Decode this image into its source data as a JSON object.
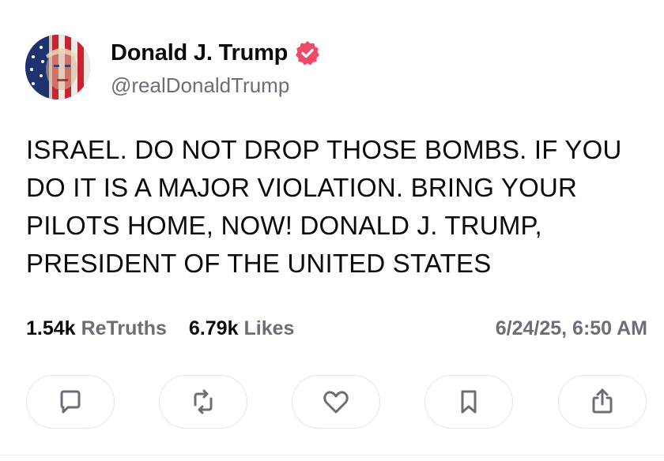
{
  "author": {
    "display_name": "Donald J. Trump",
    "handle": "@realDonaldTrump",
    "verified": true,
    "verified_color": "#ef4b64"
  },
  "post": {
    "text": "ISRAEL. DO NOT DROP THOSE BOMBS. IF YOU DO IT IS A MAJOR VIOLATION. BRING YOUR PILOTS HOME, NOW! DONALD J. TRUMP, PRESIDENT OF THE UNITED STATES"
  },
  "stats": {
    "retruths_count": "1.54k",
    "retruths_label": "ReTruths",
    "likes_count": "6.79k",
    "likes_label": "Likes",
    "timestamp": "6/24/25, 6:50 AM"
  },
  "actions": [
    {
      "icon": "reply-icon"
    },
    {
      "icon": "retruth-icon"
    },
    {
      "icon": "heart-icon"
    },
    {
      "icon": "bookmark-icon"
    },
    {
      "icon": "share-icon"
    }
  ],
  "colors": {
    "text": "#0b0b0f",
    "muted": "#6b6e78",
    "border": "#e3e4e8",
    "icon": "#6b6e78"
  }
}
